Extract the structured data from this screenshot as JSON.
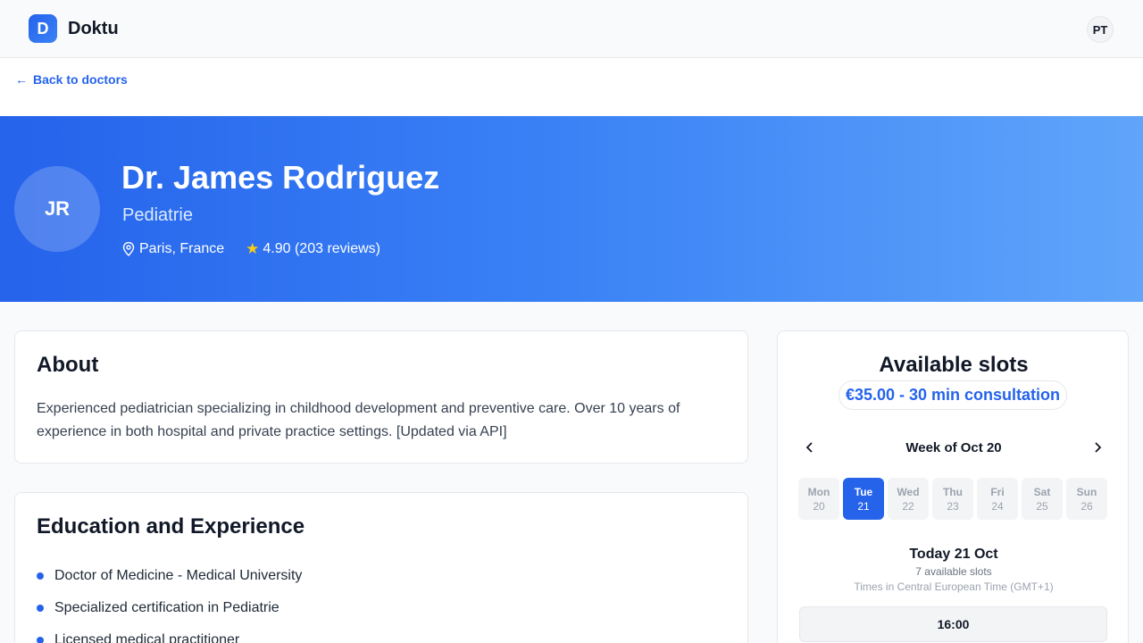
{
  "header": {
    "brand_letter": "D",
    "brand_name": "Doktu",
    "user_initials": "PT"
  },
  "nav": {
    "back_label": "Back to doctors"
  },
  "doctor": {
    "initials": "JR",
    "name": "Dr. James Rodriguez",
    "specialty": "Pediatrie",
    "location": "Paris, France",
    "rating_text": "4.90 (203 reviews)"
  },
  "about": {
    "title": "About",
    "text": "Experienced pediatrician specializing in childhood development and preventive care. Over 10 years of experience in both hospital and private practice settings. [Updated via API]"
  },
  "education": {
    "title": "Education and Experience",
    "items": [
      "Doctor of Medicine - Medical University",
      "Specialized certification in Pediatrie",
      "Licensed medical practitioner"
    ]
  },
  "slots": {
    "title": "Available slots",
    "price": "€35.00 - 30 min consultation",
    "week_label": "Week of Oct 20",
    "days": [
      {
        "name": "Mon",
        "num": "20",
        "selected": false
      },
      {
        "name": "Tue",
        "num": "21",
        "selected": true
      },
      {
        "name": "Wed",
        "num": "22",
        "selected": false
      },
      {
        "name": "Thu",
        "num": "23",
        "selected": false
      },
      {
        "name": "Fri",
        "num": "24",
        "selected": false
      },
      {
        "name": "Sat",
        "num": "25",
        "selected": false
      },
      {
        "name": "Sun",
        "num": "26",
        "selected": false
      }
    ],
    "today_label": "Today 21 Oct",
    "available_count": "7 available slots",
    "timezone": "Times in Central European Time (GMT+1)",
    "first_slot": "16:00"
  },
  "icons": {
    "back": "arrow-left-icon",
    "location": "map-pin-icon",
    "rating": "star-icon",
    "prev": "chevron-left-icon",
    "next": "chevron-right-icon"
  },
  "colors": {
    "accent": "#2563eb",
    "hero_start": "#2563eb",
    "hero_end": "#60a5fa",
    "star": "#facc15"
  }
}
